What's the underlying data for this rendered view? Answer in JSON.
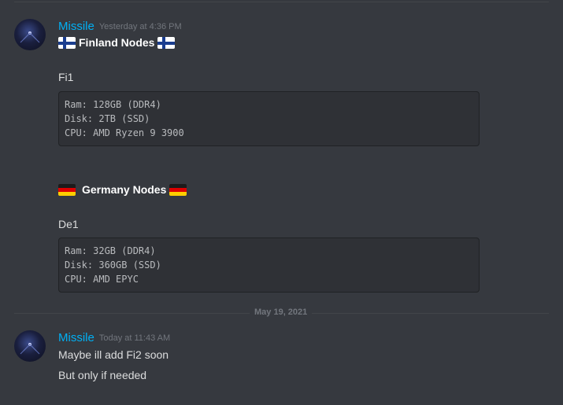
{
  "messages": [
    {
      "username": "Missile",
      "timestamp": "Yesterday at 4:36 PM",
      "sections": [
        {
          "title": "Finland Nodes",
          "node_label": "Fi1",
          "code": [
            "Ram: 128GB (DDR4)",
            "Disk: 2TB (SSD)",
            "CPU: AMD Ryzen 9 3900"
          ]
        },
        {
          "title": "Germany Nodes",
          "node_label": "De1",
          "code": [
            "Ram: 32GB (DDR4)",
            "Disk: 360GB (SSD)",
            "CPU: AMD EPYC"
          ]
        }
      ]
    },
    {
      "username": "Missile",
      "timestamp": "Today at 11:43 AM",
      "lines": [
        "Maybe ill add Fi2 soon",
        "But only if needed"
      ]
    }
  ],
  "date_divider": "May 19, 2021",
  "colors": {
    "background": "#36393f",
    "username": "#00b0f4",
    "timestamp": "#72767d",
    "codeblock_bg": "#2f3136"
  },
  "icons": [
    "flag-finland-icon",
    "flag-germany-icon"
  ]
}
